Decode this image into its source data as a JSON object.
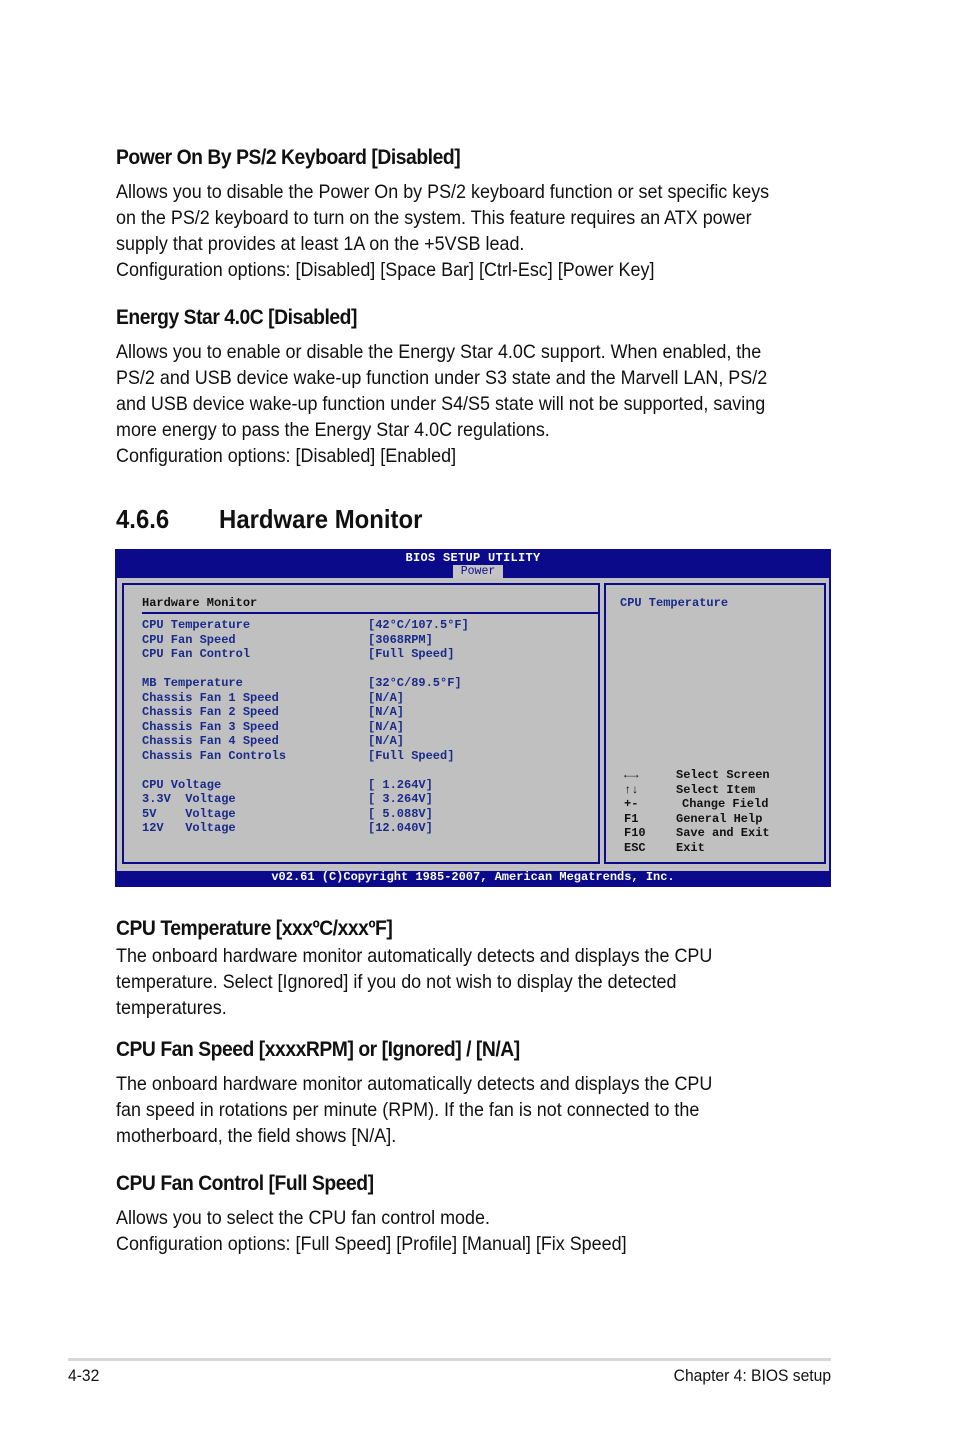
{
  "sections": [
    {
      "heading": "Power On By PS/2 Keyboard [Disabled]",
      "lines": [
        "Allows you to disable the Power On by PS/2 keyboard function or set specific keys",
        "on the PS/2 keyboard to turn on the system. This feature requires an ATX power",
        "supply that provides at least 1A on the +5VSB lead.",
        "Configuration options: [Disabled] [Space Bar] [Ctrl-Esc] [Power Key]"
      ]
    },
    {
      "heading": "Energy Star 4.0C [Disabled]",
      "lines": [
        "Allows you to enable or disable the Energy Star 4.0C support. When enabled, the",
        "PS/2 and USB device wake-up function under S3 state and the Marvell LAN, PS/2",
        "and USB device wake-up function under S4/S5 state will not be supported, saving",
        "more energy to pass the Energy Star 4.0C regulations.",
        "Configuration options: [Disabled] [Enabled]"
      ]
    },
    {
      "heading": "CPU Temperature [xxxºC/xxxºF]",
      "lines": [
        "The onboard hardware monitor automatically detects and displays the CPU",
        "temperature. Select [Ignored] if you do not wish to display the detected",
        "temperatures."
      ]
    },
    {
      "heading": "CPU Fan Speed [xxxxRPM] or [Ignored] / [N/A]",
      "lines": [
        "The onboard hardware monitor automatically detects and displays the CPU",
        "fan speed in rotations per minute (RPM). If the fan is not connected to the",
        "motherboard, the field shows [N/A]."
      ]
    },
    {
      "heading": "CPU Fan Control [Full Speed]",
      "lines": [
        "Allows you to select the CPU fan control mode.",
        "Configuration options: [Full Speed] [Profile] [Manual] [Fix Speed]"
      ]
    }
  ],
  "section_heading": {
    "number": "4.6.6",
    "title": "Hardware Monitor"
  },
  "bios": {
    "title": "BIOS SETUP UTILITY",
    "active_tab": "Power",
    "pane_title": "Hardware Monitor",
    "help_title": "CPU Temperature",
    "rows": [
      {
        "label": "CPU Temperature",
        "value": "[42°C/107.5°F]"
      },
      {
        "label": "CPU Fan Speed",
        "value": "[3068RPM]"
      },
      {
        "label": "CPU Fan Control",
        "value": "[Full Speed]"
      },
      {
        "label": "",
        "value": ""
      },
      {
        "label": "MB Temperature",
        "value": "[32°C/89.5°F]"
      },
      {
        "label": "Chassis Fan 1 Speed",
        "value": "[N/A]"
      },
      {
        "label": "Chassis Fan 2 Speed",
        "value": "[N/A]"
      },
      {
        "label": "Chassis Fan 3 Speed",
        "value": "[N/A]"
      },
      {
        "label": "Chassis Fan 4 Speed",
        "value": "[N/A]"
      },
      {
        "label": "Chassis Fan Controls",
        "value": "[Full Speed]"
      },
      {
        "label": "",
        "value": ""
      },
      {
        "label": "CPU Voltage",
        "value": "[ 1.264V]"
      },
      {
        "label": "3.3V  Voltage",
        "value": "[ 3.264V]"
      },
      {
        "label": "5V    Voltage",
        "value": "[ 5.088V]"
      },
      {
        "label": "12V   Voltage",
        "value": "[12.040V]"
      }
    ],
    "keys": [
      {
        "key": "←→",
        "icon": "left-right-arrows-icon",
        "desc": "Select Screen"
      },
      {
        "key": "↑↓",
        "icon": "up-down-arrows-icon",
        "desc": "Select Item"
      },
      {
        "key": "+-",
        "icon": "plus-minus-icon",
        "desc": "Change Field"
      },
      {
        "key": "F1",
        "icon": "",
        "desc": "General Help"
      },
      {
        "key": "F10",
        "icon": "",
        "desc": "Save and Exit"
      },
      {
        "key": "ESC",
        "icon": "",
        "desc": "Exit"
      }
    ],
    "footer": "v02.61 (C)Copyright 1985-2007, American Megatrends, Inc.",
    "colors": {
      "frame": "#0a0a8a",
      "panel": "#c0c0c0",
      "value_text": "#1a2a8a"
    }
  },
  "page_footer": {
    "page_number": "4-32",
    "chapter": "Chapter 4: BIOS setup"
  }
}
